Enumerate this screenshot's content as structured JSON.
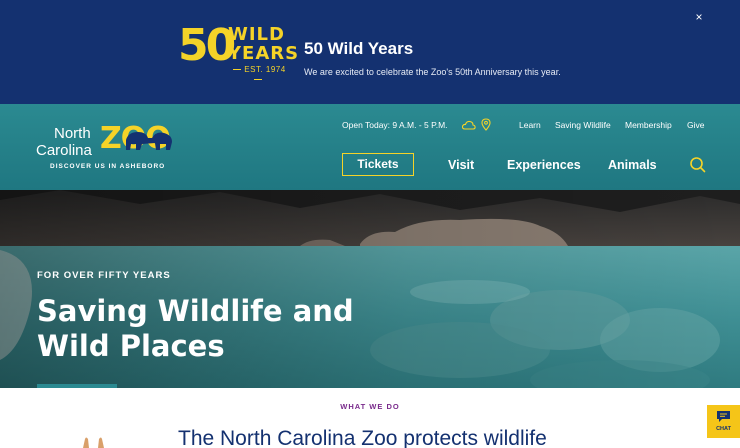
{
  "banner": {
    "anniversary_logo": {
      "number": "50",
      "word1": "WILD",
      "word2": "YEARS",
      "established": "EST. 1974"
    },
    "title": "50 Wild Years",
    "text": "We are excited to celebrate the Zoo's 50th Anniversary this year.",
    "close_icon": "×"
  },
  "header": {
    "logo": {
      "line1": "North",
      "line2": "Carolina",
      "mark": "ZOO",
      "tagline": "DISCOVER US IN ASHEBORO"
    },
    "utility": {
      "hours": "Open Today: 9 A.M. - 5 P.M.",
      "weather_icon": "cloud-icon",
      "location_icon": "map-pin-icon",
      "links": [
        "Learn",
        "Saving Wildlife",
        "Membership",
        "Give"
      ]
    },
    "main_nav": {
      "tickets": "Tickets",
      "items": [
        "Visit",
        "Experiences",
        "Animals"
      ],
      "search_icon": "search-icon"
    }
  },
  "hero": {
    "eyebrow": "FOR OVER FIFTY YEARS",
    "title": "Saving Wildlife and Wild Places"
  },
  "what_we_do": {
    "eyebrow": "WHAT WE DO",
    "heading": "The North Carolina Zoo protects wildlife"
  },
  "chat": {
    "label": "CHAT",
    "icon": "chat-bubble-icon"
  },
  "colors": {
    "banner_bg": "#143170",
    "header_bg": "#2b8a91",
    "accent_yellow": "#f5d328",
    "eyebrow_purple": "#7a2b8c",
    "heading_navy": "#143170",
    "chat_bg": "#f5c518"
  }
}
